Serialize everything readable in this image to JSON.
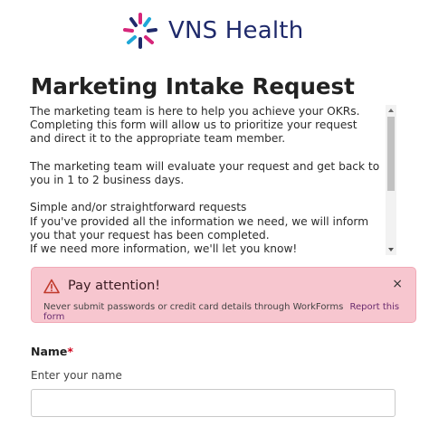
{
  "brand": {
    "name": "VNS Health",
    "logo_icon": "vns-starburst-logo",
    "colors": {
      "navy": "#1f2a6b",
      "magenta": "#d6267a",
      "cyan": "#1fa8d8"
    }
  },
  "form": {
    "title": "Marketing Intake Request",
    "description": "The marketing team is here to help you achieve your OKRs. Completing this form will allow us to prioritize your request and direct it to the appropriate team member.\n\nThe marketing team will evaluate your request and get back to you in 1 to 2 business days.\n\nSimple and/or straightforward requests\nIf you've provided all the information we need, we will inform you that your request has been completed.\nIf we need more information, we'll let you know!"
  },
  "alert": {
    "icon": "warning-triangle-icon",
    "title": "Pay attention!",
    "message": "Never submit passwords or credit card details through WorkForms",
    "link": "Report this form",
    "close_symbol": "×",
    "colors": {
      "background": "#f7c6cf",
      "icon": "#c0392b",
      "link": "#6a2c6f"
    }
  },
  "fields": {
    "name": {
      "label": "Name",
      "required_marker": "*",
      "hint": "Enter your name",
      "value": ""
    }
  }
}
